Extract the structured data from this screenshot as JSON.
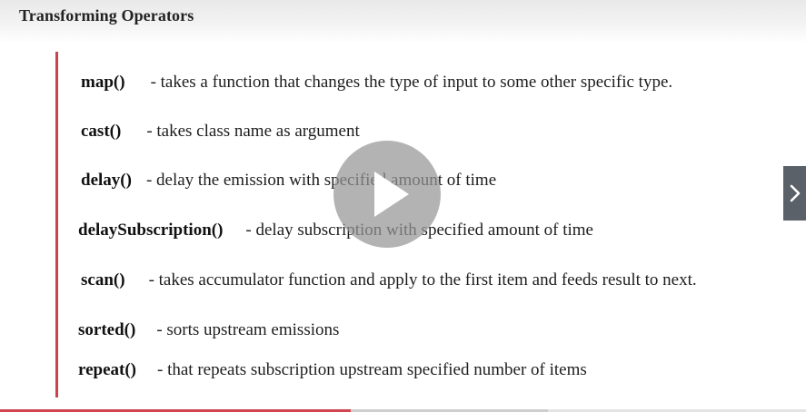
{
  "slide": {
    "title": "Transforming Operators",
    "accent_color": "#c8434d",
    "operators": [
      {
        "name": "map()",
        "description": "- takes a function that changes the type of input to some other specific type."
      },
      {
        "name": "cast()",
        "description": "- takes class name as argument"
      },
      {
        "name": "delay()",
        "description": "- delay the emission with specified amount of time"
      },
      {
        "name": "delaySubscription()",
        "description": "- delay subscription with specified amount of time"
      },
      {
        "name": "scan()",
        "description": "- takes accumulator function and apply to the first item and feeds result to next."
      },
      {
        "name": "sorted()",
        "description": "- sorts upstream emissions"
      },
      {
        "name": "repeat()",
        "description": "- that repeats subscription upstream specified number of items"
      }
    ]
  },
  "player": {
    "play_icon": "play-icon",
    "next_icon": "chevron-right-icon",
    "progress_percent": 43.5,
    "buffered_percent": 68,
    "progress_color": "#d0454f"
  }
}
